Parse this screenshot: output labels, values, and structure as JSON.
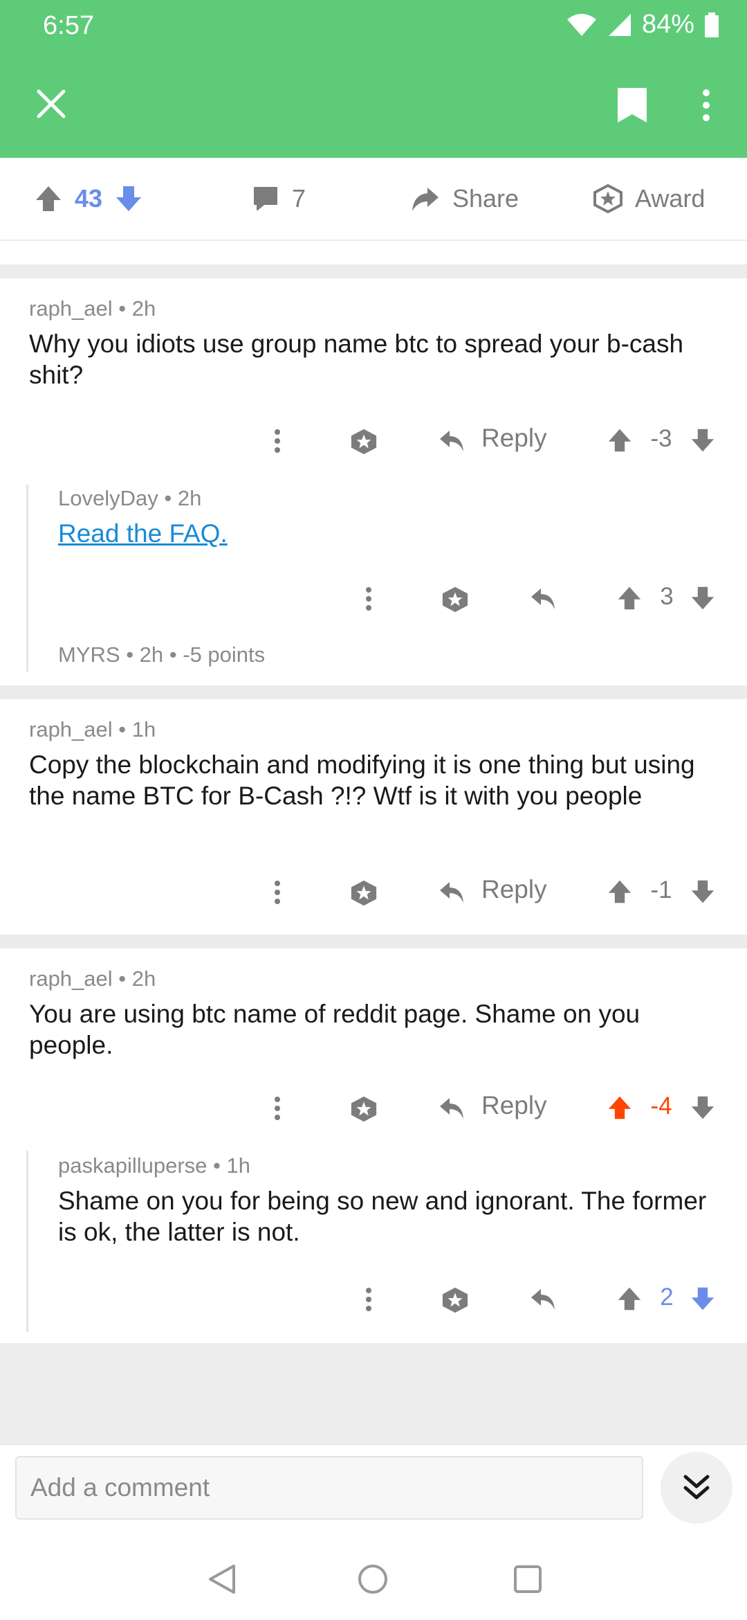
{
  "status_bar": {
    "time": "6:57",
    "battery": "84%"
  },
  "toolbar": {
    "close_icon": "close-icon",
    "bookmark_icon": "bookmark-icon",
    "more_icon": "more-vert-icon"
  },
  "post_actions": {
    "score": "43",
    "comments": "7",
    "share": "Share",
    "award": "Award"
  },
  "comments": [
    {
      "author": "raph_ael",
      "age": "2h",
      "text": "Why you idiots use group name btc to spread your b-cash shit?",
      "reply": "Reply",
      "score": "-3"
    },
    {
      "author": "LovelyDay",
      "age": "2h",
      "link_text": "Read the FAQ.",
      "score": "3"
    },
    {
      "author": "MYRS",
      "age": "2h",
      "points": "-5 points"
    },
    {
      "author": "raph_ael",
      "age": "1h",
      "text": "Copy the blockchain and modifying it is one thing but using the name BTC for B-Cash ?!? Wtf is it with you people",
      "reply": "Reply",
      "score": "-1"
    },
    {
      "author": "raph_ael",
      "age": "2h",
      "text": "You are using btc name of reddit page. Shame on you people.",
      "reply": "Reply",
      "score": "-4",
      "vote_state": "upvoted"
    },
    {
      "author": "paskapilluperse",
      "age": "1h",
      "text": "Shame on you for being so new and ignorant. The former is ok, the latter is not.",
      "score": "2",
      "vote_state": "downvoted"
    }
  ],
  "composer": {
    "placeholder": "Add a comment"
  },
  "colors": {
    "header_green": "#5ecb79",
    "upvote_orange": "#ff4500",
    "downvote_blue": "#6a8de8",
    "link_blue": "#1a8ad6"
  }
}
